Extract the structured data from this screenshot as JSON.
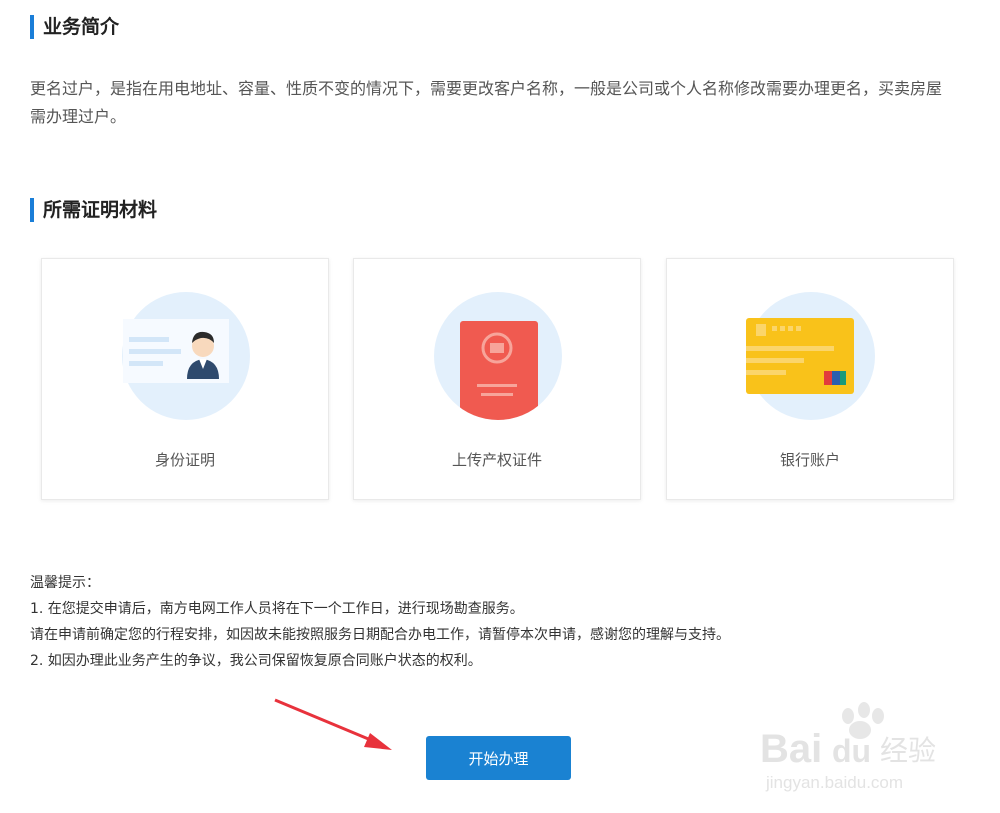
{
  "intro": {
    "title": "业务简介",
    "text": "更名过户，是指在用电地址、容量、性质不变的情况下，需要更改客户名称，一般是公司或个人名称修改需要办理更名，买卖房屋需办理过户。"
  },
  "materials": {
    "title": "所需证明材料",
    "items": [
      {
        "label": "身份证明",
        "icon": "id-card-icon"
      },
      {
        "label": "上传产权证件",
        "icon": "property-certificate-icon"
      },
      {
        "label": "银行账户",
        "icon": "bank-card-icon"
      }
    ]
  },
  "tips": {
    "heading": "温馨提示：",
    "lines": [
      "1. 在您提交申请后，南方电网工作人员将在下一个工作日，进行现场勘查服务。",
      "请在申请前确定您的行程安排，如因故未能按照服务日期配合办电工作，请暂停本次申请，感谢您的理解与支持。",
      "2. 如因办理此业务产生的争议，我公司保留恢复原合同账户状态的权利。"
    ]
  },
  "actions": {
    "start_label": "开始办理"
  },
  "watermark": {
    "brand": "Bai",
    "brand2": "du",
    "cn": "经验",
    "url": "jingyan.baidu.com"
  },
  "colors": {
    "accent": "#1a7ed8",
    "button": "#1a82d2",
    "arrow": "#e8323c",
    "icon_circle": "#e3f0fc",
    "passport_red": "#f05a50",
    "card_yellow": "#f9c21a"
  }
}
